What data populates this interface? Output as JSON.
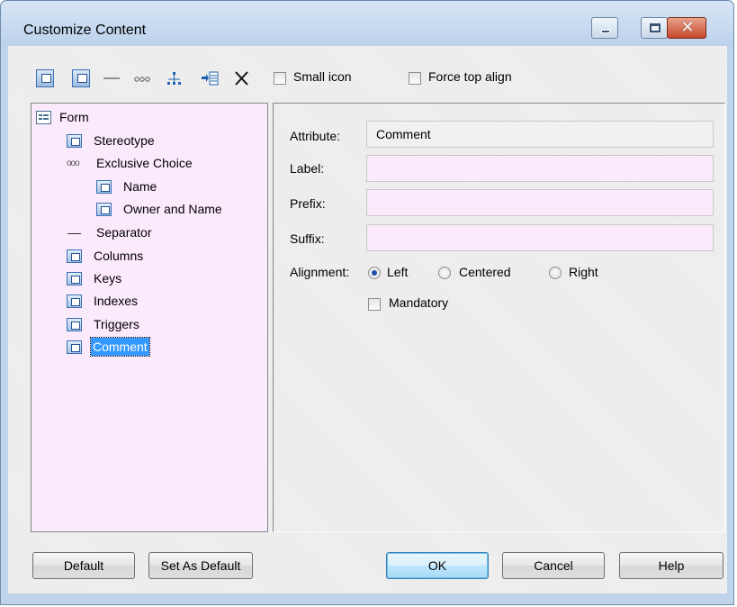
{
  "window": {
    "title": "Customize Content"
  },
  "toolbar": {
    "small_icon_label": "Small icon",
    "force_top_align_label": "Force top align"
  },
  "tree": {
    "items": [
      {
        "label": "Form",
        "icon": "form-icon"
      },
      {
        "label": "Stereotype",
        "icon": "element-icon"
      },
      {
        "label": "Exclusive Choice",
        "icon": "choice-icon"
      },
      {
        "label": "Name",
        "icon": "element-icon"
      },
      {
        "label": "Owner and Name",
        "icon": "element-icon"
      },
      {
        "label": "Separator",
        "icon": "separator-icon"
      },
      {
        "label": "Columns",
        "icon": "element-icon"
      },
      {
        "label": "Keys",
        "icon": "element-icon"
      },
      {
        "label": "Indexes",
        "icon": "element-icon"
      },
      {
        "label": "Triggers",
        "icon": "element-icon"
      },
      {
        "label": "Comment",
        "icon": "element-icon",
        "selected": true
      }
    ]
  },
  "props": {
    "attribute_label": "Attribute:",
    "attribute_value": "Comment",
    "label_label": "Label:",
    "label_value": "",
    "prefix_label": "Prefix:",
    "prefix_value": "",
    "suffix_label": "Suffix:",
    "suffix_value": "",
    "alignment_label": "Alignment:",
    "alignment_options": [
      "Left",
      "Centered",
      "Right"
    ],
    "alignment_selected": "Left",
    "mandatory_label": "Mandatory"
  },
  "buttons": {
    "default": "Default",
    "set_as_default": "Set As Default",
    "ok": "OK",
    "cancel": "Cancel",
    "help": "Help"
  },
  "colors": {
    "field_bg": "#fbeafb",
    "selection": "#3399ff"
  }
}
